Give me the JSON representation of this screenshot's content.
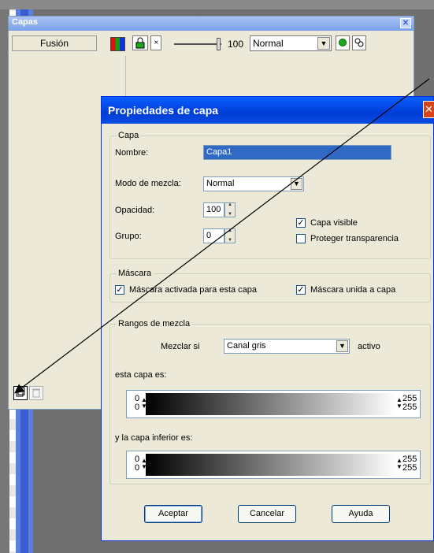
{
  "layers_panel": {
    "title": "Capas",
    "close": "✕",
    "layer_name": "Fusión",
    "opacity": "100",
    "blend_mode": "Normal",
    "lock_icon": "lock-icon",
    "new_layer_icon": "new-layer-icon",
    "delete_icon": "trash-icon"
  },
  "dialog": {
    "title": "Propiedades de capa",
    "close": "✕",
    "capa": {
      "legend": "Capa",
      "name_label": "Nombre:",
      "name_value": "Capa1",
      "blend_label": "Modo de mezcla:",
      "blend_value": "Normal",
      "opacity_label": "Opacidad:",
      "opacity_value": "100",
      "group_label": "Grupo:",
      "group_value": "0",
      "visible_label": "Capa visible",
      "visible_checked": true,
      "protect_label": "Proteger transparencia",
      "protect_checked": false
    },
    "mascara": {
      "legend": "Máscara",
      "enabled_label": "Máscara activada para esta capa",
      "enabled_checked": true,
      "linked_label": "Máscara unida a capa",
      "linked_checked": true
    },
    "rangos": {
      "legend": "Rangos de mezcla",
      "mix_label": "Mezclar si",
      "channel_value": "Canal gris",
      "active_label": "activo",
      "this_layer_label": "esta capa es:",
      "lower_layer_label": "y la capa inferior es:",
      "low_top": "0",
      "low_bottom": "0",
      "high_top": "255",
      "high_bottom": "255"
    },
    "buttons": {
      "ok": "Aceptar",
      "cancel": "Cancelar",
      "help": "Ayuda"
    }
  },
  "colors": {
    "title_blue": "#0a5fff",
    "panel_bg": "#ece9d8",
    "selection": "#316ac5"
  }
}
